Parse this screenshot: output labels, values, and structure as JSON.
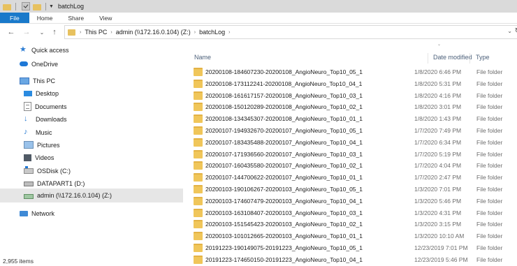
{
  "window": {
    "title": "batchLog"
  },
  "ribbon": {
    "tabs": [
      "File",
      "Home",
      "Share",
      "View"
    ]
  },
  "address": {
    "crumbs": [
      "This PC",
      "admin (\\\\172.16.0.104) (Z:)",
      "batchLog"
    ]
  },
  "nav": {
    "items": [
      {
        "label": "Quick access",
        "icon": "star-icon"
      },
      {
        "label": "OneDrive",
        "icon": "cloud-icon"
      },
      {
        "label": "This PC",
        "icon": "computer-icon"
      },
      {
        "label": "Desktop",
        "icon": "desktop-icon"
      },
      {
        "label": "Documents",
        "icon": "documents-icon"
      },
      {
        "label": "Downloads",
        "icon": "download-icon"
      },
      {
        "label": "Music",
        "icon": "music-icon"
      },
      {
        "label": "Pictures",
        "icon": "pictures-icon"
      },
      {
        "label": "Videos",
        "icon": "videos-icon"
      },
      {
        "label": "OSDisk (C:)",
        "icon": "disk-icon"
      },
      {
        "label": "DATAPART1 (D:)",
        "icon": "drive-icon"
      },
      {
        "label": "admin (\\\\172.16.0.104) (Z:)",
        "icon": "network-drive-icon"
      },
      {
        "label": "Network",
        "icon": "network-icon"
      }
    ]
  },
  "columns": {
    "name": "Name",
    "date": "Date modified",
    "type": "Type"
  },
  "files": [
    {
      "name": "20200108-184607230-20200108_AngioNeuro_Top10_05_1",
      "date": "1/8/2020 6:46 PM",
      "type": "File folder"
    },
    {
      "name": "20200108-173112241-20200108_AngioNeuro_Top10_04_1",
      "date": "1/8/2020 5:31 PM",
      "type": "File folder"
    },
    {
      "name": "20200108-161617157-20200108_AngioNeuro_Top10_03_1",
      "date": "1/8/2020 4:16 PM",
      "type": "File folder"
    },
    {
      "name": "20200108-150120289-20200108_AngioNeuro_Top10_02_1",
      "date": "1/8/2020 3:01 PM",
      "type": "File folder"
    },
    {
      "name": "20200108-134345307-20200108_AngioNeuro_Top10_01_1",
      "date": "1/8/2020 1:43 PM",
      "type": "File folder"
    },
    {
      "name": "20200107-194932670-20200107_AngioNeuro_Top10_05_1",
      "date": "1/7/2020 7:49 PM",
      "type": "File folder"
    },
    {
      "name": "20200107-183435488-20200107_AngioNeuro_Top10_04_1",
      "date": "1/7/2020 6:34 PM",
      "type": "File folder"
    },
    {
      "name": "20200107-171936560-20200107_AngioNeuro_Top10_03_1",
      "date": "1/7/2020 5:19 PM",
      "type": "File folder"
    },
    {
      "name": "20200107-160435580-20200107_AngioNeuro_Top10_02_1",
      "date": "1/7/2020 4:04 PM",
      "type": "File folder"
    },
    {
      "name": "20200107-144700622-20200107_AngioNeuro_Top10_01_1",
      "date": "1/7/2020 2:47 PM",
      "type": "File folder"
    },
    {
      "name": "20200103-190106267-20200103_AngioNeuro_Top10_05_1",
      "date": "1/3/2020 7:01 PM",
      "type": "File folder"
    },
    {
      "name": "20200103-174607479-20200103_AngioNeuro_Top10_04_1",
      "date": "1/3/2020 5:46 PM",
      "type": "File folder"
    },
    {
      "name": "20200103-163108407-20200103_AngioNeuro_Top10_03_1",
      "date": "1/3/2020 4:31 PM",
      "type": "File folder"
    },
    {
      "name": "20200103-151545423-20200103_AngioNeuro_Top10_02_1",
      "date": "1/3/2020 3:15 PM",
      "type": "File folder"
    },
    {
      "name": "20200103-101012665-20200103_AngioNeuro_Top10_01_1",
      "date": "1/3/2020 10:10 AM",
      "type": "File folder"
    },
    {
      "name": "20191223-190149075-20191223_AngioNeuro_Top10_05_1",
      "date": "12/23/2019 7:01 PM",
      "type": "File folder"
    },
    {
      "name": "20191223-174650150-20191223_AngioNeuro_Top10_04_1",
      "date": "12/23/2019 5:46 PM",
      "type": "File folder"
    }
  ],
  "status": {
    "count": "2,955 items"
  },
  "colors": {
    "accent": "#1979ca",
    "folder": "#f0c65a",
    "selected": "#e6e6e6"
  }
}
